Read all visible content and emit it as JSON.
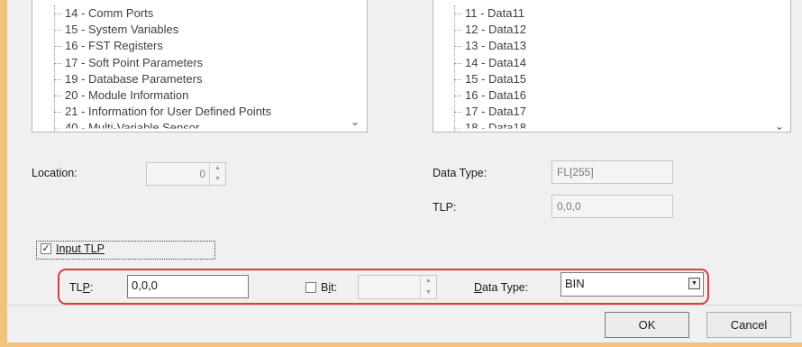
{
  "left_tree": {
    "items": [
      "14 - Comm Ports",
      "15 - System Variables",
      "16 - FST Registers",
      "17 - Soft Point Parameters",
      "19 - Database Parameters",
      "20 - Module Information",
      "21 - Information for User Defined Points",
      "40 - Multi-Variable Sensor"
    ]
  },
  "right_tree": {
    "items": [
      "11 - Data11",
      "12 - Data12",
      "13 - Data13",
      "14 - Data14",
      "15 - Data15",
      "16 - Data16",
      "17 - Data17",
      "18 - Data18"
    ]
  },
  "location": {
    "label": "Location:",
    "value": "0"
  },
  "data_type_readonly": {
    "label": "Data Type:",
    "value": "FL[255]"
  },
  "tlp_readonly": {
    "label": "TLP:",
    "value": "0,0,0"
  },
  "input_tlp": {
    "label": "Input TLP",
    "checked": true
  },
  "tlp_input": {
    "label_pre": "TL",
    "label_ul": "P",
    "label_post": ":",
    "value": "0,0,0"
  },
  "bit": {
    "label_pre": "B",
    "label_ul": "i",
    "label_post": "t:",
    "checked": false,
    "value": ""
  },
  "data_type_select": {
    "label_ul": "D",
    "label_post": "ata Type:",
    "value": "BIN"
  },
  "buttons": {
    "ok": "OK",
    "cancel": "Cancel"
  },
  "colors": {
    "highlight": "#e03a3a",
    "frame": "#f4c27a"
  }
}
